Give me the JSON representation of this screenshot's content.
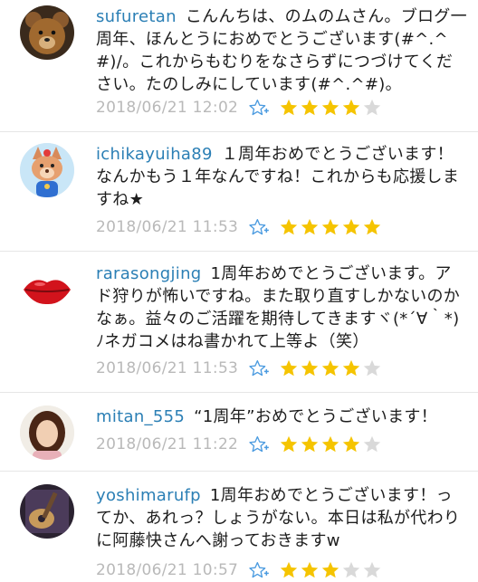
{
  "colors": {
    "username": "#2b7fb5",
    "star_on": "#f5c400",
    "star_off": "#d9d9d9",
    "add_star_icon": "#4b9be0",
    "timestamp": "#b9b9b9"
  },
  "comments": [
    {
      "username": "sufuretan",
      "text": "こんんちは、のムのムさん。ブログ一周年、ほんとうにおめでとうございます(#^.^#)/。これからもむりをなさらずにつづけてください。たのしみにしています(#^.^#)。",
      "timestamp": "2018/06/21 12:02",
      "rating": 4,
      "avatar_icon": "teddy-bear-avatar"
    },
    {
      "username": "ichikayuiha89",
      "text": "１周年おめでとうございます！なんかもう１年なんですね！これからも応援しますね★",
      "timestamp": "2018/06/21 11:53",
      "rating": 5,
      "avatar_icon": "cartoon-dog-avatar"
    },
    {
      "username": "rarasongjing",
      "text": "1周年おめでとうございます。アド狩りが怖いですね。また取り直すしかないのかなぁ。益々のご活躍を期待してきますヾ(*´∀｀*)ﾉネガコメはね書かれて上等よ（笑）",
      "timestamp": "2018/06/21 11:53",
      "rating": 4,
      "avatar_icon": "red-lips-avatar"
    },
    {
      "username": "mitan_555",
      "text": "“1周年”おめでとうございます！",
      "timestamp": "2018/06/21 11:22",
      "rating": 4,
      "avatar_icon": "woman-portrait-avatar"
    },
    {
      "username": "yoshimarufp",
      "text": "1周年おめでとうございます！ってか、あれっ？しょうがない。本日は私が代わりに阿藤快さんへ謝っておきますw",
      "timestamp": "2018/06/21 10:57",
      "rating": 3,
      "avatar_icon": "guitar-photo-avatar"
    }
  ]
}
